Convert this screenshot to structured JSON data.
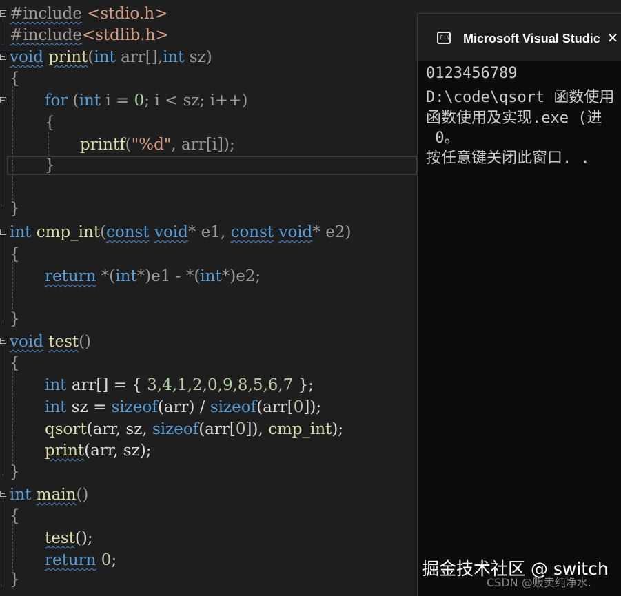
{
  "editor": {
    "inc1": {
      "directive": "#include",
      "file": " <stdio.h>"
    },
    "inc2": {
      "directive": "#include",
      "file": "<stdlib.h>"
    },
    "print_sig": {
      "void": "void",
      "sp": " ",
      "name": "print",
      "open": "(",
      "int1": "int",
      "arr": " arr[],",
      "int2": "int",
      "sz": " sz",
      "close": ")"
    },
    "brace_open": "{",
    "brace_close": "}",
    "for_line": {
      "for": "for",
      "p1": " (",
      "int": "int",
      "rest1": " i = ",
      "zero": "0",
      "rest2": "; i < sz; i++)"
    },
    "printf_line": {
      "fn": "printf",
      "p1": "(",
      "str": "\"%d\"",
      "rest": ", arr[i]);"
    },
    "cmp_sig": {
      "int": "int",
      "sp1": " ",
      "name": "cmp_int",
      "p1": "(",
      "const1": "const",
      "sp2": " ",
      "void1": "void",
      "e1": "* e1, ",
      "const2": "const",
      "sp3": " ",
      "void2": "void",
      "e2": "* e2)"
    },
    "return_line": {
      "ret": "return",
      "t1": " *(",
      "int1": "int",
      "t2": "*)e1 - *(",
      "int2": "int",
      "t3": "*)e2;"
    },
    "test_sig": {
      "void": "void",
      "sp": " ",
      "name": "test",
      "rest": "()"
    },
    "arr_line": {
      "int": "int",
      "t1": " arr[] = { ",
      "nums": "3,4,1,2,0,9,8,5,6,7",
      "t2": " };"
    },
    "sz_line": {
      "int": "int",
      "t1": " sz = ",
      "sizeof1": "sizeof",
      "t2": "(arr) / ",
      "sizeof2": "sizeof",
      "t3": "(arr[",
      "zero": "0",
      "t4": "]);"
    },
    "qsort_line": {
      "fn": "qsort",
      "t1": "(arr, sz, ",
      "sizeof": "sizeof",
      "t2": "(arr[",
      "zero": "0",
      "t3": "]), ",
      "cmp": "cmp_int",
      "t4": ");"
    },
    "printcall_line": {
      "fn": "print",
      "t1": "(arr, sz);"
    },
    "main_sig": {
      "int": "int",
      "sp": " ",
      "name": "main",
      "rest": "()"
    },
    "testcall_line": {
      "fn": "test",
      "t1": "();"
    },
    "return0_line": {
      "ret": "return",
      "sp": " ",
      "zero": "0",
      "t1": ";"
    }
  },
  "console": {
    "title": "Microsoft Visual Studic",
    "icon_text": "C:\\",
    "lines": [
      "0123456789",
      "D:\\code\\qsort 函数使用",
      "函数使用及实现.exe (进",
      " 0。",
      "按任意键关闭此窗口. ."
    ]
  },
  "watermark": {
    "main": "掘金技术社区 @ switch",
    "sub": "CSDN @贩卖纯净水."
  },
  "colors": {
    "keyword": "#569cd6",
    "function": "#dcdcaa",
    "string": "#d69d85",
    "number": "#b5cea8",
    "text": "#dcdcdc",
    "squiggle": "#4f8ed6"
  }
}
